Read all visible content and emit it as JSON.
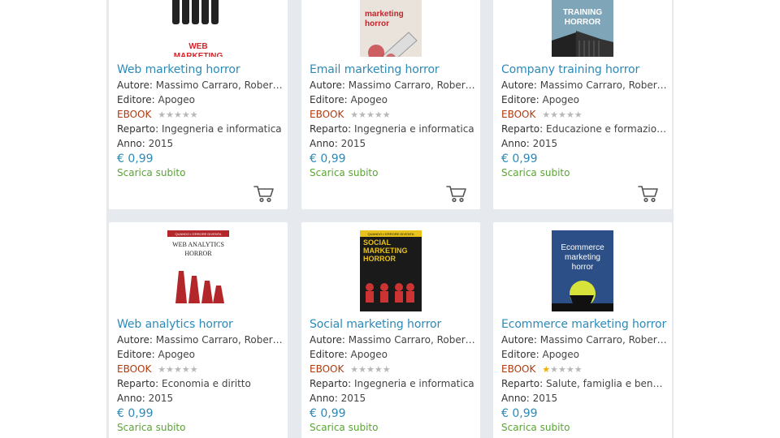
{
  "products": [
    {
      "title": "Web marketing horror",
      "author_label": "Autore:",
      "author": "Massimo Carraro, Robert…",
      "publisher_label": "Editore:",
      "publisher": "Apogeo",
      "format": "EBOOK",
      "rating": 0,
      "department_label": "Reparto:",
      "department": "Ingegneria e informatica",
      "year_label": "Anno:",
      "year": "2015",
      "price": "€ 0,99",
      "availability": "Scarica subito",
      "cover_text": [
        "WEB",
        "MARKETING",
        "HORROR"
      ],
      "cover_bg": "#ffffff",
      "cover_accent": "#d6232a"
    },
    {
      "title": "Email marketing horror",
      "author_label": "Autore:",
      "author": "Massimo Carraro, Robert…",
      "publisher_label": "Editore:",
      "publisher": "Apogeo",
      "format": "EBOOK",
      "rating": 0,
      "department_label": "Reparto:",
      "department": "Ingegneria e informatica",
      "year_label": "Anno:",
      "year": "2015",
      "price": "€ 0,99",
      "availability": "Scarica subito",
      "cover_text": [
        "marketing",
        "horror"
      ],
      "cover_bg": "#e9e3dc",
      "cover_accent": "#c0272d"
    },
    {
      "title": "Company training horror",
      "author_label": "Autore:",
      "author": "Massimo Carraro, Robert…",
      "publisher_label": "Editore:",
      "publisher": "Apogeo",
      "format": "EBOOK",
      "rating": 0,
      "department_label": "Reparto:",
      "department": "Educazione e formazione",
      "year_label": "Anno:",
      "year": "2015",
      "price": "€ 0,99",
      "availability": "Scarica subito",
      "cover_text": [
        "TRAINING",
        "HORROR"
      ],
      "cover_bg": "#7fa6b8",
      "cover_accent": "#222222"
    },
    {
      "title": "Web analytics horror",
      "author_label": "Autore:",
      "author": "Massimo Carraro, Robert…",
      "publisher_label": "Editore:",
      "publisher": "Apogeo",
      "format": "EBOOK",
      "rating": 0,
      "department_label": "Reparto:",
      "department": "Economia e diritto",
      "year_label": "Anno:",
      "year": "2015",
      "price": "€ 0,99",
      "availability": "Scarica subito",
      "cover_text": [
        "QUANDO L'ERRORE DIVENTA",
        "WEB ANALYTICS",
        "HORROR"
      ],
      "cover_bg": "#ffffff",
      "cover_accent": "#b3262a"
    },
    {
      "title": "Social marketing horror",
      "author_label": "Autore:",
      "author": "Massimo Carraro, Robert…",
      "publisher_label": "Editore:",
      "publisher": "Apogeo",
      "format": "EBOOK",
      "rating": 0,
      "department_label": "Reparto:",
      "department": "Ingegneria e informatica",
      "year_label": "Anno:",
      "year": "2015",
      "price": "€ 0,99",
      "availability": "Scarica subito",
      "cover_text": [
        "QUANDO L'ERRORE DIVENTA",
        "SOCIAL",
        "MARKETING",
        "HORROR"
      ],
      "cover_bg": "#1a1a1a",
      "cover_accent": "#e8c21a"
    },
    {
      "title": "Ecommerce marketing horror",
      "author_label": "Autore:",
      "author": "Massimo Carraro, Robert…",
      "publisher_label": "Editore:",
      "publisher": "Apogeo",
      "format": "EBOOK",
      "rating": 1,
      "department_label": "Reparto:",
      "department": "Salute, famiglia e benes…",
      "year_label": "Anno:",
      "year": "2015",
      "price": "€ 0,99",
      "availability": "Scarica subito",
      "cover_text": [
        "Ecommerce",
        "marketing",
        "horror"
      ],
      "cover_bg": "#2b4f86",
      "cover_accent": "#d7e33a"
    }
  ],
  "colors": {
    "title": "#2c8ab8",
    "price": "#2c8ab8",
    "format": "#b03a0f",
    "availability": "#5aa335",
    "star_on": "#f0b000",
    "star_off": "#b8b8b8",
    "grid_bg": "#e6e9ed"
  },
  "icons": {
    "cart": "shopping-cart-icon",
    "star": "star-icon"
  }
}
